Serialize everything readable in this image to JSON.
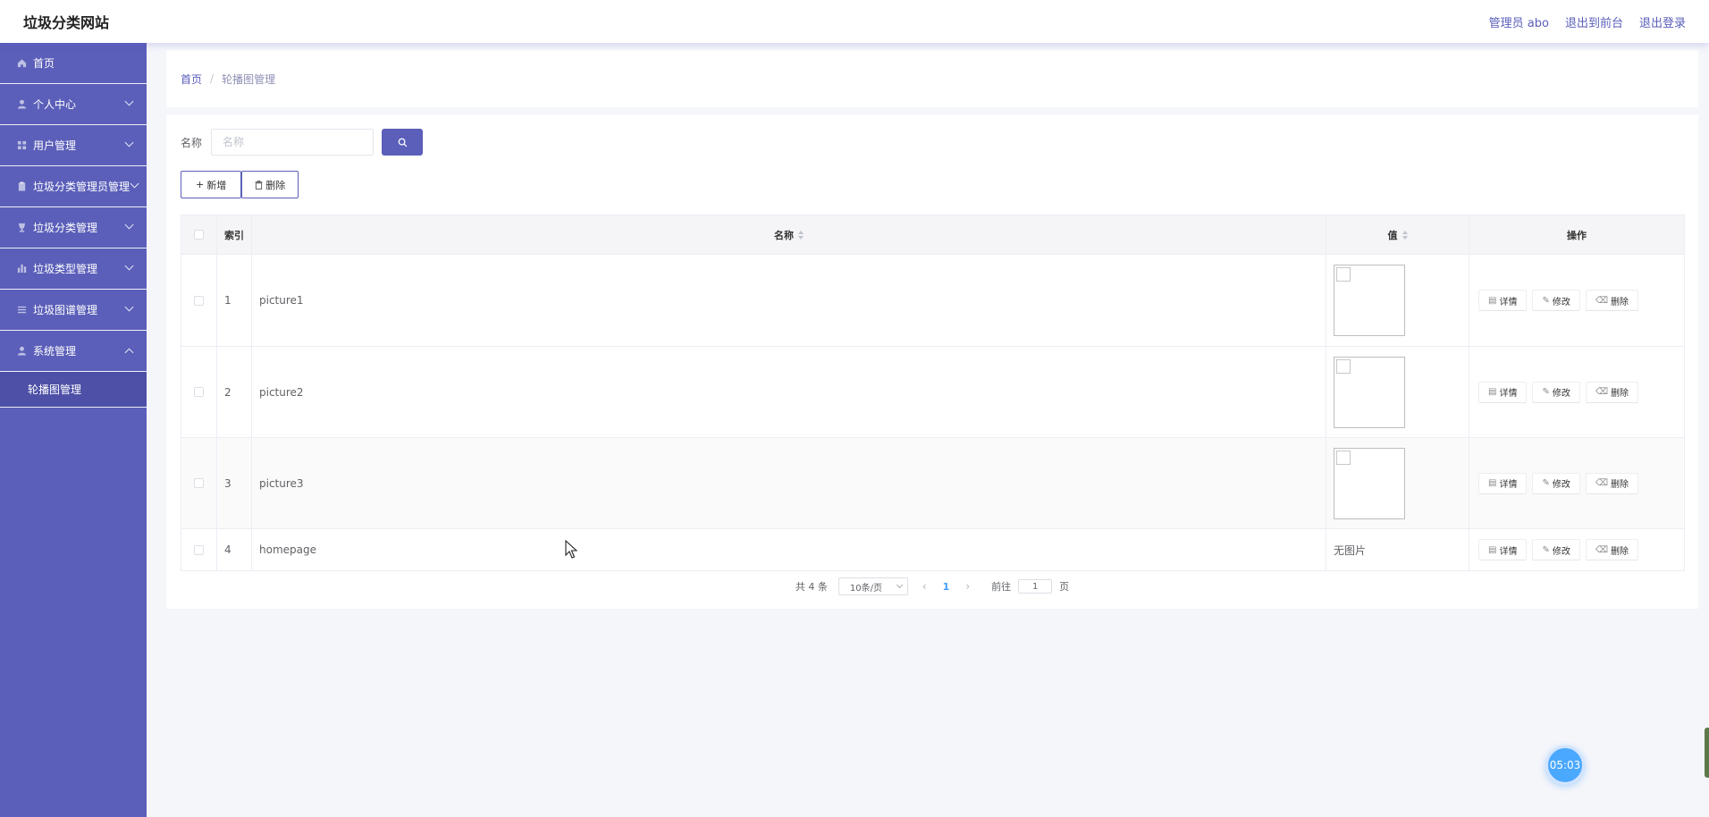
{
  "header": {
    "site_title": "垃圾分类网站",
    "admin_label": "管理员 abo",
    "back_label": "退出到前台",
    "logout_label": "退出登录"
  },
  "sidebar": {
    "items": [
      {
        "label": "首页",
        "icon": "home-icon"
      },
      {
        "label": "个人中心",
        "icon": "user-icon"
      },
      {
        "label": "用户管理",
        "icon": "grid-icon"
      },
      {
        "label": "垃圾分类管理员管理",
        "icon": "clipboard-icon"
      },
      {
        "label": "垃圾分类管理",
        "icon": "cup-icon"
      },
      {
        "label": "垃圾类型管理",
        "icon": "bar-chart-icon"
      },
      {
        "label": "垃圾图谱管理",
        "icon": "list-icon"
      },
      {
        "label": "系统管理",
        "icon": "user-icon"
      }
    ],
    "sub_item": "轮播图管理"
  },
  "breadcrumb": {
    "home": "首页",
    "sep": "/",
    "current": "轮播图管理"
  },
  "search": {
    "label": "名称",
    "placeholder": "名称"
  },
  "actions": {
    "add_label": "新增",
    "delete_label": "删除"
  },
  "table": {
    "headers": {
      "index": "索引",
      "name": "名称",
      "value": "值",
      "ops": "操作"
    },
    "rows": [
      {
        "index": "1",
        "name": "picture1",
        "value": ""
      },
      {
        "index": "2",
        "name": "picture2",
        "value": ""
      },
      {
        "index": "3",
        "name": "picture3",
        "value": ""
      },
      {
        "index": "4",
        "name": "homepage",
        "value": "无图片"
      }
    ],
    "op_labels": {
      "detail": "详情",
      "edit": "修改",
      "delete": "删除"
    }
  },
  "pagination": {
    "total": "共 4 条",
    "page_size": "10条/页",
    "current_page": "1",
    "goto_prefix": "前往",
    "goto_value": "1",
    "goto_suffix": "页"
  },
  "timer": "05:03",
  "colors": {
    "primary": "#5b5fb9",
    "link": "#409eff"
  }
}
